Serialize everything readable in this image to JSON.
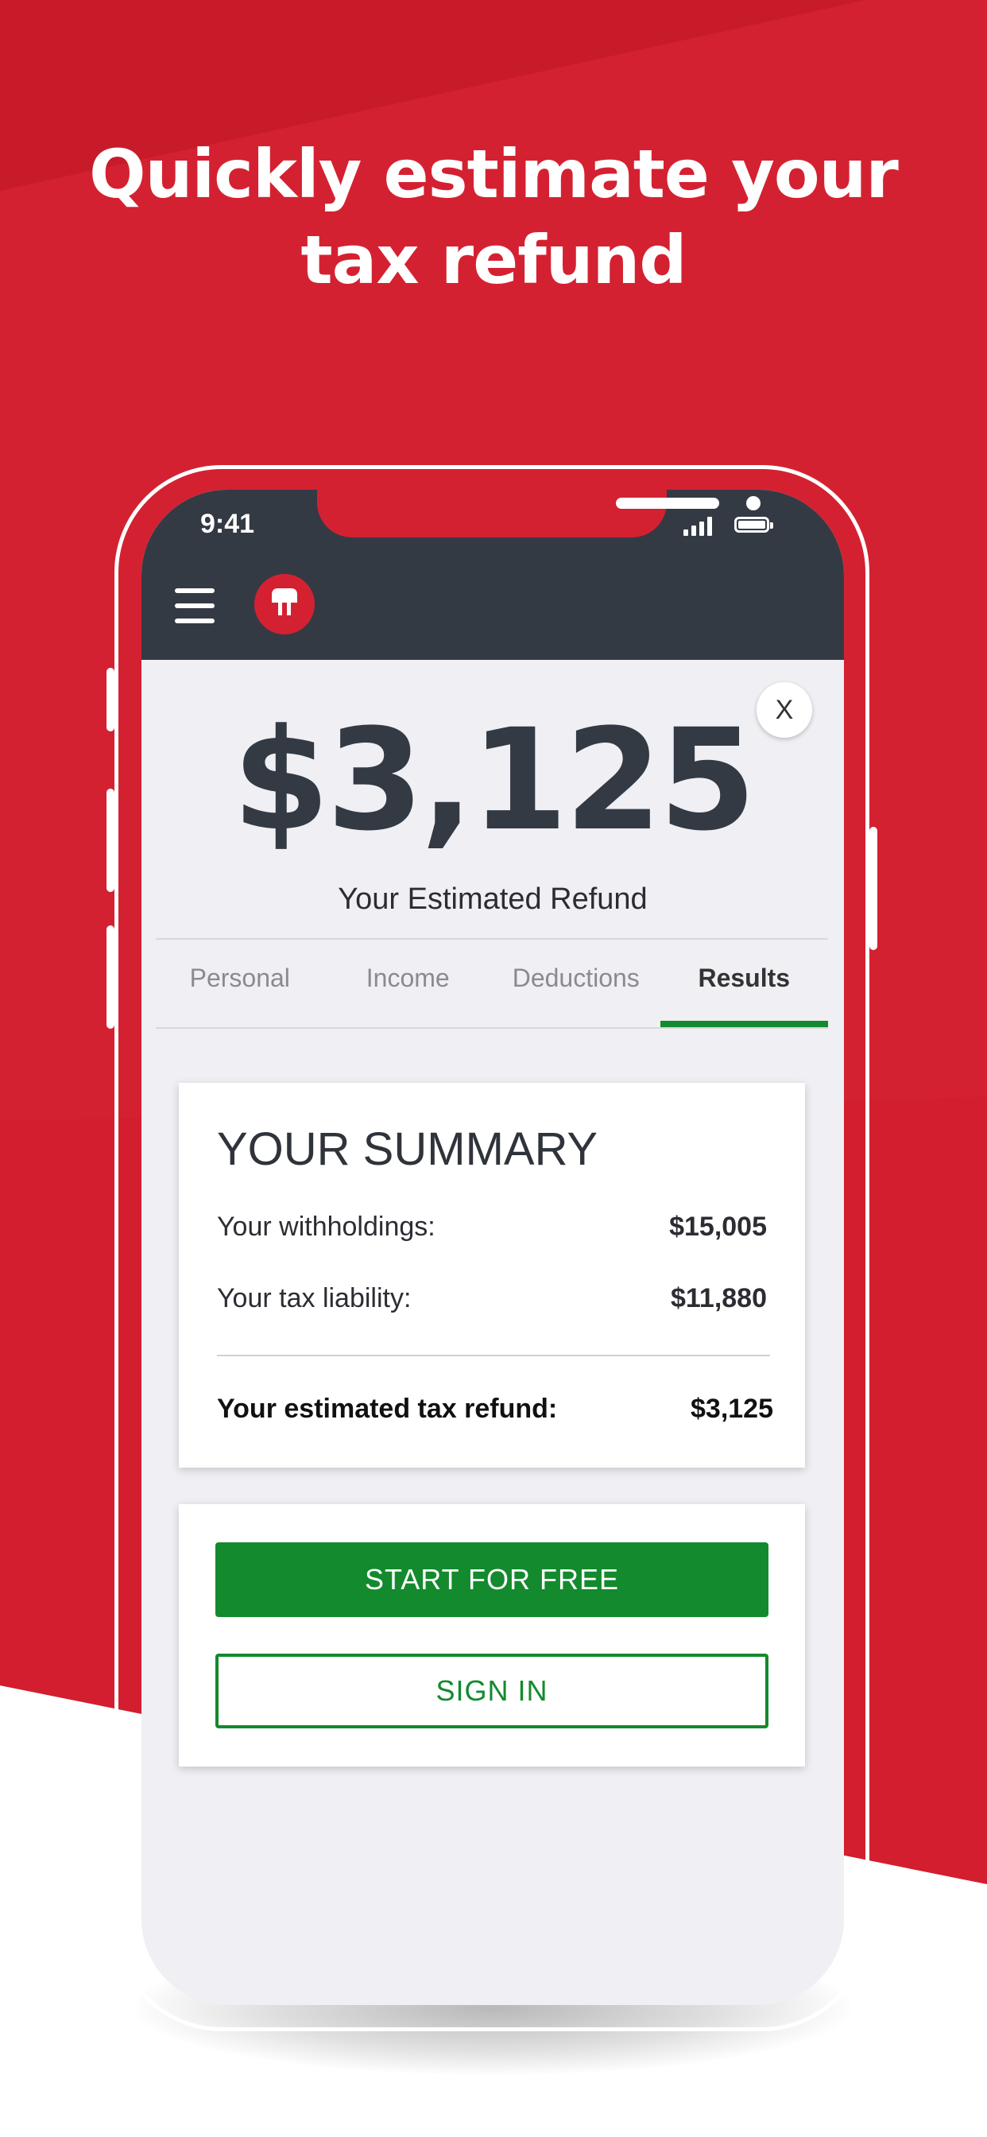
{
  "headline": {
    "line1": "Quickly estimate your",
    "line2": "tax refund"
  },
  "colors": {
    "brand_red": "#d42131",
    "brand_red_dark": "#c81b29",
    "app_bar": "#343a44",
    "accent_green": "#138a2d",
    "screen_bg": "#efeff4"
  },
  "status_bar": {
    "time": "9:41",
    "icons": [
      "signal-bars-icon",
      "battery-icon"
    ]
  },
  "app_bar": {
    "icons": [
      "hamburger-menu-icon",
      "spartan-helmet-logo"
    ]
  },
  "refund": {
    "amount": "$3,125",
    "label": "Your Estimated Refund",
    "close_label": "X"
  },
  "tabs": [
    {
      "label": "Personal",
      "active": false
    },
    {
      "label": "Income",
      "active": false
    },
    {
      "label": "Deductions",
      "active": false
    },
    {
      "label": "Results",
      "active": true
    }
  ],
  "summary": {
    "title": "YOUR SUMMARY",
    "rows": [
      {
        "label": "Your withholdings:",
        "value": "$15,005"
      },
      {
        "label": "Your tax liability:",
        "value": "$11,880"
      }
    ],
    "total": {
      "label": "Your estimated tax refund:",
      "value": "$3,125"
    }
  },
  "actions": {
    "primary": "START FOR FREE",
    "secondary": "SIGN IN"
  }
}
